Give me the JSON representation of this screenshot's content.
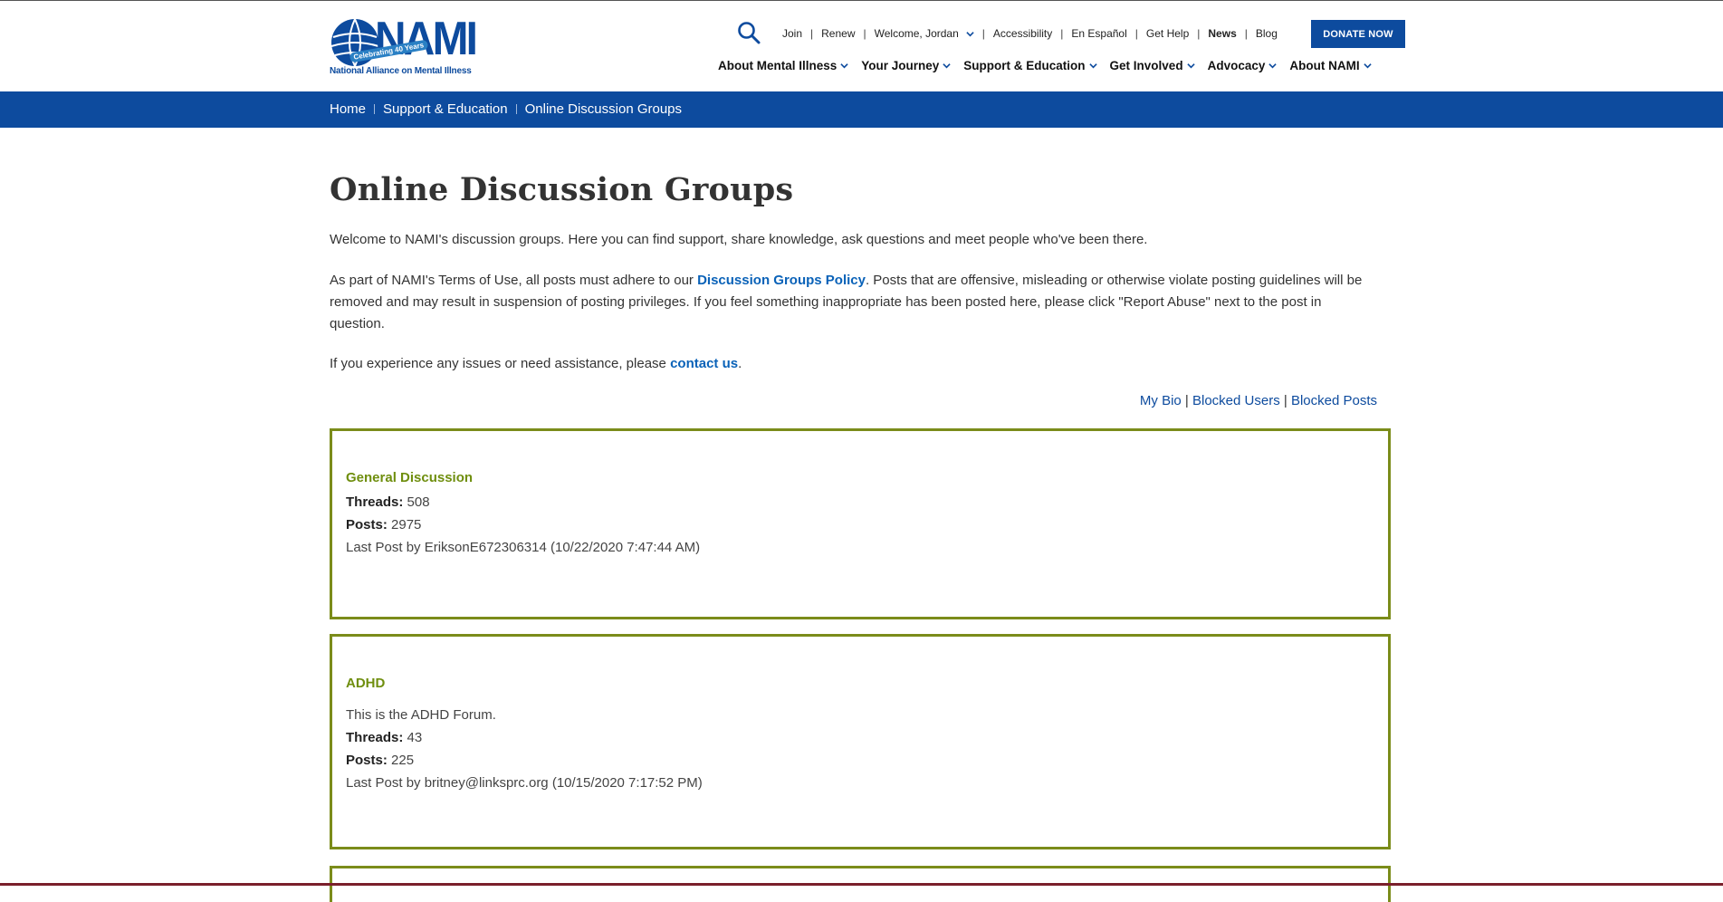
{
  "header": {
    "logo": {
      "wordmark": "NAMI",
      "tagline": "National Alliance on Mental Illness",
      "anniversary": "Celebrating 40 Years"
    },
    "utility": {
      "join": "Join",
      "renew": "Renew",
      "welcome": "Welcome, Jordan",
      "accessibility": "Accessibility",
      "espanol": "En Español",
      "get_help": "Get Help",
      "news": "News",
      "blog": "Blog"
    },
    "donate_label": "DONATE NOW",
    "nav": [
      {
        "label": "About Mental Illness"
      },
      {
        "label": "Your Journey"
      },
      {
        "label": "Support & Education"
      },
      {
        "label": "Get Involved"
      },
      {
        "label": "Advocacy"
      },
      {
        "label": "About NAMI"
      }
    ]
  },
  "breadcrumb": {
    "home": "Home",
    "section": "Support & Education",
    "current": "Online Discussion Groups"
  },
  "page": {
    "title": "Online Discussion Groups",
    "intro": "Welcome to NAMI's discussion groups. Here you can find support, share knowledge, ask questions and meet people who've been there.",
    "terms_before": "As part of NAMI's Terms of Use, all posts must adhere to our ",
    "terms_link": "Discussion Groups Policy",
    "terms_after": ". Posts that are offensive, misleading or otherwise violate posting guidelines will be removed and may result in suspension of posting privileges. If you feel something inappropriate has been posted here, please click \"Report Abuse\" next to the post in question.",
    "contact_before": "If you experience any issues or need assistance, please ",
    "contact_link": "contact us",
    "contact_after": "."
  },
  "user_links": {
    "my_bio": "My Bio",
    "blocked_users": "Blocked Users",
    "blocked_posts": "Blocked Posts",
    "separator": "|"
  },
  "groups": [
    {
      "title": "General Discussion",
      "description": "",
      "threads_label": "Threads:",
      "threads": "508",
      "posts_label": "Posts:",
      "posts": "2975",
      "last_post": "Last Post by EriksonE672306314 (10/22/2020 7:47:44 AM)"
    },
    {
      "title": "ADHD",
      "description": "This is the ADHD Forum.",
      "threads_label": "Threads:",
      "threads": "43",
      "posts_label": "Posts:",
      "posts": "225",
      "last_post": "Last Post by britney@linksprc.org (10/15/2020 7:17:52 PM)"
    }
  ],
  "colors": {
    "brand_blue": "#0d4b9e",
    "link_blue": "#0a62b8",
    "group_border": "#7b8c1a",
    "group_title": "#6f8e0e"
  }
}
